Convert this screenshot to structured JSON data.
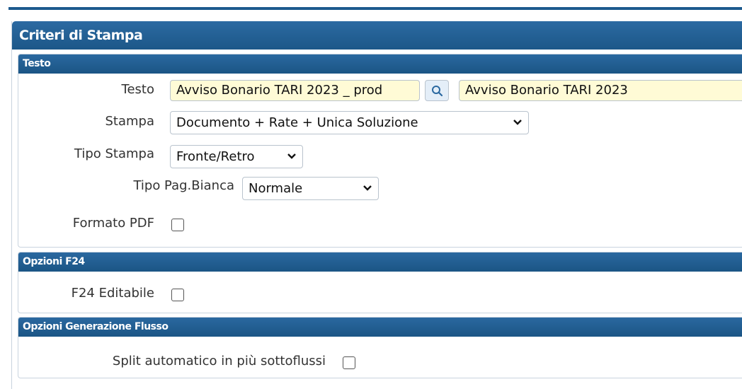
{
  "panel": {
    "title": "Criteri di Stampa"
  },
  "sections": {
    "testo": {
      "header": "Testo",
      "testo_label": "Testo",
      "testo_code_value": "Avviso Bonario TARI 2023 _ prod",
      "testo_description_value": "Avviso Bonario TARI 2023",
      "stampa_label": "Stampa",
      "stampa_value": "Documento + Rate + Unica Soluzione",
      "tipo_stampa_label": "Tipo Stampa",
      "tipo_stampa_value": "Fronte/Retro",
      "tipo_pag_bianca_label": "Tipo Pag.Bianca",
      "tipo_pag_bianca_value": "Normale",
      "formato_pdf_label": "Formato PDF",
      "formato_pdf_checked": false
    },
    "f24": {
      "header": "Opzioni F24",
      "f24_editabile_label": "F24 Editabile",
      "f24_editabile_checked": false
    },
    "flusso": {
      "header": "Opzioni Generazione Flusso",
      "split_label": "Split automatico in più sottoflussi",
      "split_checked": false
    }
  },
  "icons": {
    "search": "search-icon",
    "dropdown": "chevron-down-icon"
  },
  "colors": {
    "header_blue": "#1c5788",
    "input_yellow": "#fffbd6"
  }
}
